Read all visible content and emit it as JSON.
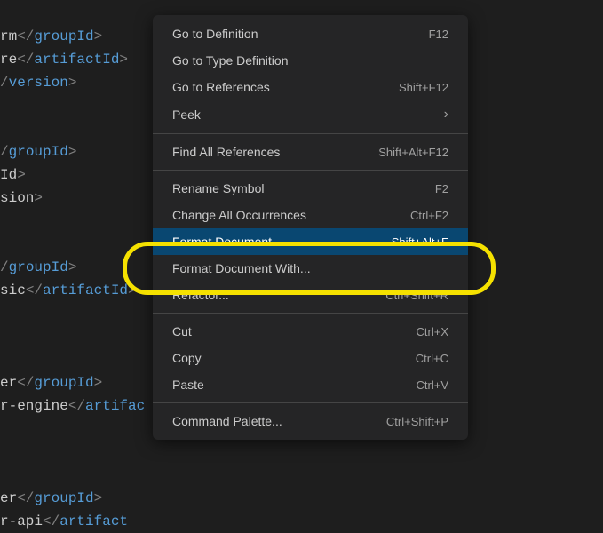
{
  "editor": {
    "lines": [
      {
        "segments": [
          {
            "cls": "t-txt",
            "t": "rm"
          },
          {
            "cls": "t-gray",
            "t": "</"
          },
          {
            "cls": "t-blue",
            "t": "groupId"
          },
          {
            "cls": "t-gray",
            "t": ">"
          }
        ]
      },
      {
        "segments": [
          {
            "cls": "t-txt",
            "t": "re"
          },
          {
            "cls": "t-gray",
            "t": "</"
          },
          {
            "cls": "t-blue",
            "t": "artifactId"
          },
          {
            "cls": "t-gray",
            "t": ">"
          }
        ]
      },
      {
        "segments": [
          {
            "cls": "t-gray",
            "t": "/"
          },
          {
            "cls": "t-blue",
            "t": "version"
          },
          {
            "cls": "t-gray",
            "t": ">"
          }
        ]
      },
      {
        "segments": []
      },
      {
        "segments": []
      },
      {
        "segments": [
          {
            "cls": "t-gray",
            "t": "/"
          },
          {
            "cls": "t-blue",
            "t": "groupId"
          },
          {
            "cls": "t-gray",
            "t": ">"
          }
        ]
      },
      {
        "segments": [
          {
            "cls": "t-txt",
            "t": "Id"
          },
          {
            "cls": "t-gray",
            "t": ">"
          }
        ]
      },
      {
        "segments": [
          {
            "cls": "t-txt",
            "t": "sion"
          },
          {
            "cls": "t-gray",
            "t": ">"
          }
        ]
      },
      {
        "segments": []
      },
      {
        "segments": []
      },
      {
        "segments": [
          {
            "cls": "t-gray",
            "t": "/"
          },
          {
            "cls": "t-blue",
            "t": "groupId"
          },
          {
            "cls": "t-gray",
            "t": ">"
          }
        ]
      },
      {
        "segments": [
          {
            "cls": "t-txt",
            "t": "sic"
          },
          {
            "cls": "t-gray",
            "t": "</"
          },
          {
            "cls": "t-blue",
            "t": "artifactId"
          },
          {
            "cls": "t-gray",
            "t": ">"
          }
        ]
      },
      {
        "segments": []
      },
      {
        "segments": []
      },
      {
        "segments": []
      },
      {
        "segments": [
          {
            "cls": "t-txt",
            "t": "er"
          },
          {
            "cls": "t-gray",
            "t": "</"
          },
          {
            "cls": "t-blue",
            "t": "groupId"
          },
          {
            "cls": "t-gray",
            "t": ">"
          }
        ]
      },
      {
        "segments": [
          {
            "cls": "t-txt",
            "t": "r-engine"
          },
          {
            "cls": "t-gray",
            "t": "</"
          },
          {
            "cls": "t-blue",
            "t": "artifac"
          }
        ]
      },
      {
        "segments": []
      },
      {
        "segments": []
      },
      {
        "segments": []
      },
      {
        "segments": [
          {
            "cls": "t-txt",
            "t": "er"
          },
          {
            "cls": "t-gray",
            "t": "</"
          },
          {
            "cls": "t-blue",
            "t": "groupId"
          },
          {
            "cls": "t-gray",
            "t": ">"
          }
        ]
      },
      {
        "segments": [
          {
            "cls": "t-txt",
            "t": "r-api"
          },
          {
            "cls": "t-gray",
            "t": "</"
          },
          {
            "cls": "t-blue",
            "t": "artifact"
          }
        ]
      }
    ]
  },
  "menu": {
    "groups": [
      [
        {
          "label": "Go to Definition",
          "shortcut": "F12",
          "icon": null,
          "highlighted": false
        },
        {
          "label": "Go to Type Definition",
          "shortcut": "",
          "icon": null,
          "highlighted": false
        },
        {
          "label": "Go to References",
          "shortcut": "Shift+F12",
          "icon": null,
          "highlighted": false
        },
        {
          "label": "Peek",
          "shortcut": "",
          "icon": "chevron",
          "highlighted": false
        }
      ],
      [
        {
          "label": "Find All References",
          "shortcut": "Shift+Alt+F12",
          "icon": null,
          "highlighted": false
        }
      ],
      [
        {
          "label": "Rename Symbol",
          "shortcut": "F2",
          "icon": null,
          "highlighted": false
        },
        {
          "label": "Change All Occurrences",
          "shortcut": "Ctrl+F2",
          "icon": null,
          "highlighted": false
        },
        {
          "label": "Format Document",
          "shortcut": "Shift+Alt+F",
          "icon": null,
          "highlighted": true
        },
        {
          "label": "Format Document With...",
          "shortcut": "",
          "icon": null,
          "highlighted": false
        },
        {
          "label": "Refactor...",
          "shortcut": "Ctrl+Shift+R",
          "icon": null,
          "highlighted": false
        }
      ],
      [
        {
          "label": "Cut",
          "shortcut": "Ctrl+X",
          "icon": null,
          "highlighted": false
        },
        {
          "label": "Copy",
          "shortcut": "Ctrl+C",
          "icon": null,
          "highlighted": false
        },
        {
          "label": "Paste",
          "shortcut": "Ctrl+V",
          "icon": null,
          "highlighted": false
        }
      ],
      [
        {
          "label": "Command Palette...",
          "shortcut": "Ctrl+Shift+P",
          "icon": null,
          "highlighted": false
        }
      ]
    ]
  }
}
